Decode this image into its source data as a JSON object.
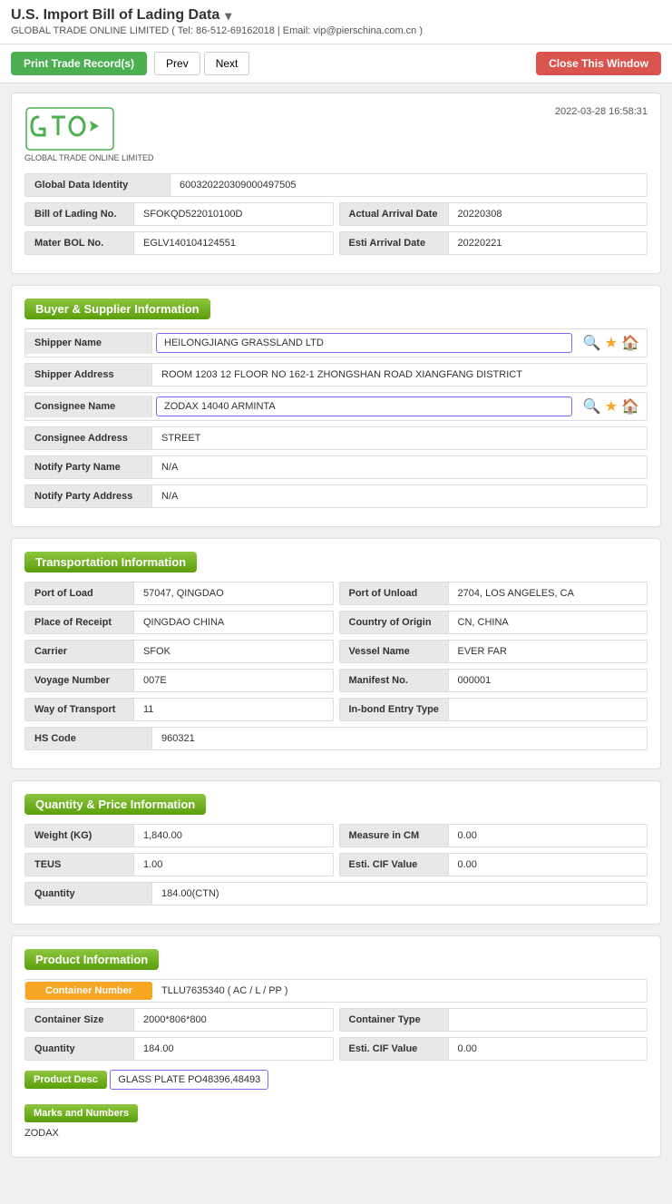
{
  "page": {
    "title": "U.S. Import Bill of Lading Data",
    "subtitle": "GLOBAL TRADE ONLINE LIMITED ( Tel: 86-512-69162018 | Email: vip@pierschina.com.cn )",
    "timestamp": "2022-03-28 16:58:31"
  },
  "toolbar": {
    "print_label": "Print Trade Record(s)",
    "prev_label": "Prev",
    "next_label": "Next",
    "close_label": "Close This Window"
  },
  "logo": {
    "tagline": "GLOBAL TRADE ONLINE LIMITED"
  },
  "record": {
    "global_data_identity_label": "Global Data Identity",
    "global_data_identity_value": "600320220309000497505",
    "bol_label": "Bill of Lading No.",
    "bol_value": "SFOKQD522010100D",
    "actual_arrival_label": "Actual Arrival Date",
    "actual_arrival_value": "20220308",
    "master_bol_label": "Mater BOL No.",
    "master_bol_value": "EGLV140104124551",
    "esti_arrival_label": "Esti Arrival Date",
    "esti_arrival_value": "20220221"
  },
  "buyer_supplier": {
    "section_label": "Buyer & Supplier Information",
    "shipper_name_label": "Shipper Name",
    "shipper_name_value": "HEILONGJIANG GRASSLAND LTD",
    "shipper_address_label": "Shipper Address",
    "shipper_address_value": "ROOM 1203 12 FLOOR NO 162-1 ZHONGSHAN ROAD XIANGFANG DISTRICT",
    "consignee_name_label": "Consignee Name",
    "consignee_name_value": "ZODAX 14040 ARMINTA",
    "consignee_address_label": "Consignee Address",
    "consignee_address_value": "STREET",
    "notify_party_label": "Notify Party Name",
    "notify_party_value": "N/A",
    "notify_party_address_label": "Notify Party Address",
    "notify_party_address_value": "N/A"
  },
  "transportation": {
    "section_label": "Transportation Information",
    "port_load_label": "Port of Load",
    "port_load_value": "57047, QINGDAO",
    "port_unload_label": "Port of Unload",
    "port_unload_value": "2704, LOS ANGELES, CA",
    "place_receipt_label": "Place of Receipt",
    "place_receipt_value": "QINGDAO CHINA",
    "country_origin_label": "Country of Origin",
    "country_origin_value": "CN, CHINA",
    "carrier_label": "Carrier",
    "carrier_value": "SFOK",
    "vessel_name_label": "Vessel Name",
    "vessel_name_value": "EVER FAR",
    "voyage_number_label": "Voyage Number",
    "voyage_number_value": "007E",
    "manifest_no_label": "Manifest No.",
    "manifest_no_value": "000001",
    "way_transport_label": "Way of Transport",
    "way_transport_value": "11",
    "inbond_label": "In-bond Entry Type",
    "inbond_value": "",
    "hs_code_label": "HS Code",
    "hs_code_value": "960321"
  },
  "quantity_price": {
    "section_label": "Quantity & Price Information",
    "weight_label": "Weight (KG)",
    "weight_value": "1,840.00",
    "measure_label": "Measure in CM",
    "measure_value": "0.00",
    "teus_label": "TEUS",
    "teus_value": "1.00",
    "esti_cif_label": "Esti. CIF Value",
    "esti_cif_value": "0.00",
    "quantity_label": "Quantity",
    "quantity_value": "184.00(CTN)"
  },
  "product": {
    "section_label": "Product Information",
    "container_number_label": "Container Number",
    "container_number_value": "TLLU7635340 ( AC / L / PP )",
    "container_size_label": "Container Size",
    "container_size_value": "2000*806*800",
    "container_type_label": "Container Type",
    "container_type_value": "",
    "quantity_label": "Quantity",
    "quantity_value": "184.00",
    "esti_cif_label": "Esti. CIF Value",
    "esti_cif_value": "0.00",
    "product_desc_label": "Product Desc",
    "product_desc_value": "GLASS PLATE PO48396,48493",
    "marks_label": "Marks and Numbers",
    "marks_value": "ZODAX"
  }
}
